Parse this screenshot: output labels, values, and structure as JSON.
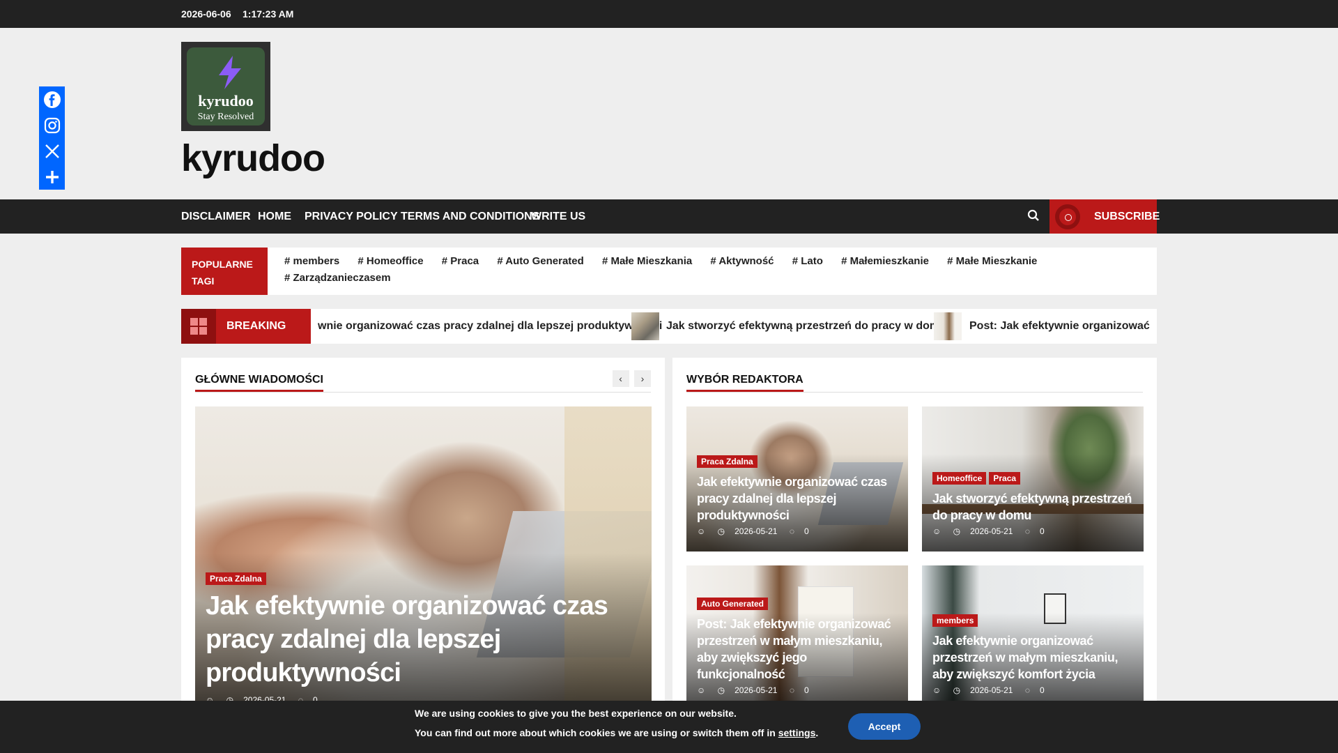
{
  "topbar": {
    "date": "2026-06-06",
    "time": "1:17:23 AM"
  },
  "site": {
    "logo_name": "kyrudoo",
    "logo_tagline": "Stay Resolved",
    "title": "kyrudoo"
  },
  "share": [
    "Facebook",
    "Instagram",
    "X",
    "Share"
  ],
  "nav": {
    "items": [
      "DISCLAIMER",
      "HOME",
      "PRIVACY POLICY",
      "TERMS AND CONDITIONS",
      "WRITE US"
    ],
    "subscribe": "SUBSCRIBE"
  },
  "tags": {
    "label": "POPULARNE TAGI",
    "items": [
      "# members",
      "# Homeoffice",
      "# Praca",
      "# Auto Generated",
      "# Małe Mieszkania",
      "# Aktywność",
      "# Lato",
      "# Małemieszkanie",
      "# Małe Mieszkanie",
      "# Zarządzanieczasem"
    ]
  },
  "breaking": {
    "label": "BREAKING NEWS",
    "items": [
      "wnie organizować czas pracy zdalnej dla lepszej produktywności",
      "Jak stworzyć efektywną przestrzeń do pracy w domu",
      "Post: Jak efektywnie organizować przest"
    ]
  },
  "main_news": {
    "heading": "GŁÓWNE WIADOMOŚCI",
    "prev": "‹",
    "next": "›",
    "featured": {
      "category": "Praca Zdalna",
      "title": "Jak efektywnie organizować czas pracy zdalnej dla lepszej produktywności",
      "date": "2026-05-21",
      "comments": "0"
    }
  },
  "editors_pick": {
    "heading": "WYBÓR REDAKTORA",
    "cards": [
      {
        "categories": [
          "Praca Zdalna"
        ],
        "title": "Jak efektywnie organizować czas pracy zdalnej dla lepszej produktywności",
        "date": "2026-05-21",
        "comments": "0"
      },
      {
        "categories": [
          "Homeoffice",
          "Praca"
        ],
        "title": "Jak stworzyć efektywną przestrzeń do pracy w domu",
        "date": "2026-05-21",
        "comments": "0"
      },
      {
        "categories": [
          "Auto Generated"
        ],
        "title": "Post: Jak efektywnie organizować przestrzeń w małym mieszkaniu, aby zwiększyć jego funkcjonalność",
        "date": "2026-05-21",
        "comments": "0"
      },
      {
        "categories": [
          "members"
        ],
        "title": "Jak efektywnie organizować przestrzeń w małym mieszkaniu, aby zwiększyć komfort życia",
        "date": "2026-05-21",
        "comments": "0"
      }
    ]
  },
  "cookie": {
    "line1": "We are using cookies to give you the best experience on our website.",
    "line2_prefix": "You can find out more about which cookies we are using or switch them off in",
    "line2_link": "settings",
    "line2_suffix": ".",
    "accept": "Accept"
  },
  "colors": {
    "accent": "#bb1919",
    "dark": "#222222",
    "share": "#0066ff",
    "accept": "#1e5fb3"
  }
}
